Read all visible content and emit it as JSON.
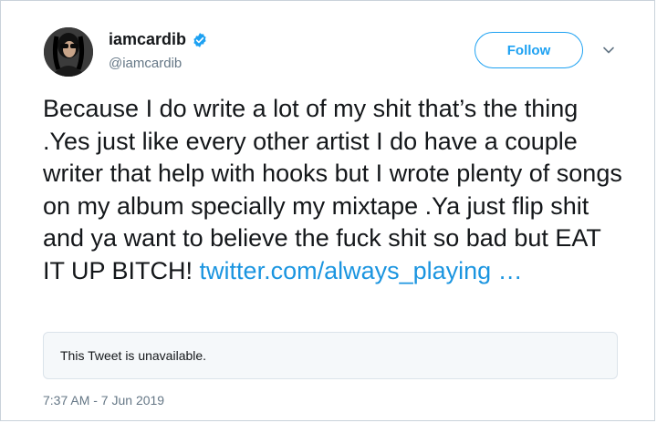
{
  "user": {
    "display_name": "iamcardib",
    "handle": "@iamcardib",
    "verified": true,
    "avatar_icon": "profile-avatar"
  },
  "actions": {
    "follow_label": "Follow",
    "menu_icon": "chevron-down-icon"
  },
  "tweet": {
    "text": "Because I do write a lot of my shit that’s the thing .Yes just like every other artist I do have a couple writer that help with hooks but I wrote plenty of songs on my album specially my mixtape .Ya just flip shit and ya want to believe the fuck shit so bad but EAT IT UP BITCH! ",
    "link_text": "twitter.com/always_playing …",
    "quoted_unavailable": "This Tweet is unavailable.",
    "timestamp": "7:37 AM - 7 Jun 2019"
  },
  "colors": {
    "accent": "#1da1f2",
    "link": "#1b95e0",
    "text": "#14171a",
    "muted": "#657786"
  }
}
